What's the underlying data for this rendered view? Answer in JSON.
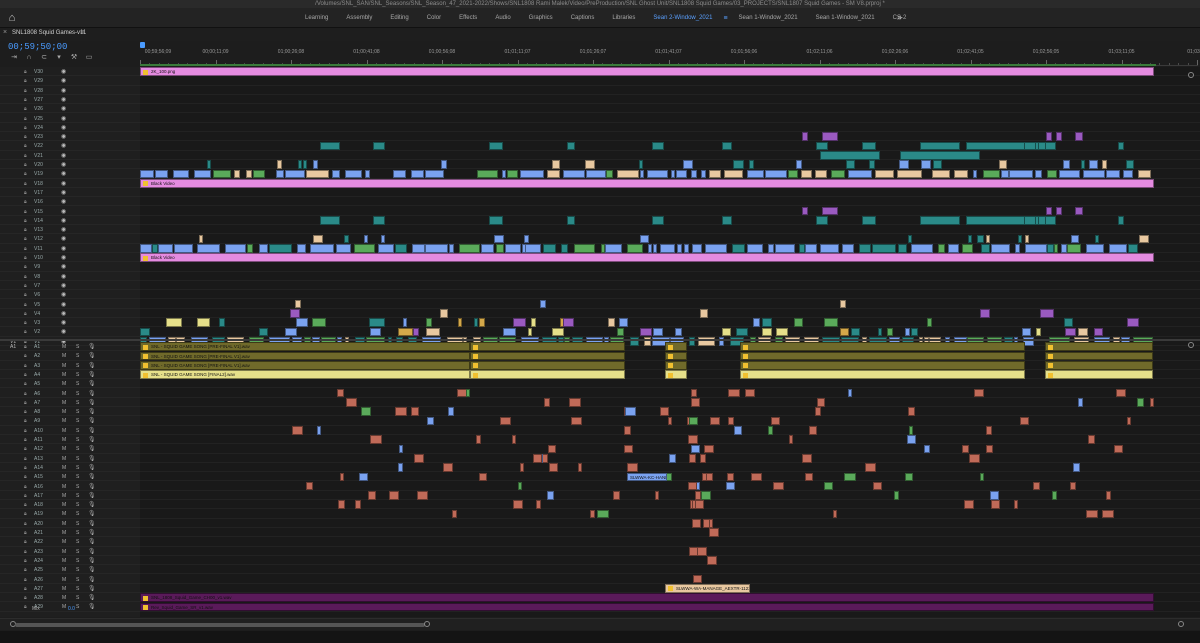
{
  "title": "/Volumes/SNL_SAN/SNL_Seasons/SNL_Season_47_2021-2022/Shows/SNL1808 Rami Malek/Video/PreProduction/SNL Ghost Unit/SNL1808 Squid Games/03_PROJECTS/SNL1807 Squid Games - SM V8.prproj *",
  "workspace": {
    "tabs": [
      "Learning",
      "Assembly",
      "Editing",
      "Color",
      "Effects",
      "Audio",
      "Graphics",
      "Captions",
      "Libraries"
    ],
    "active_tab": "Sean 2-Window_2021",
    "other_tabs": [
      "Sean 1-Window_2021",
      "Sean 1-Window_2021",
      "CS-2"
    ],
    "more_icon": "double-chevron-right-icon"
  },
  "sequence": {
    "name": "SNL1808 Squid Games-v11",
    "timecode": "00;59;50;00"
  },
  "ruler": {
    "labels": [
      "00;59;56;09",
      "00;00;11;09",
      "01;00;26;08",
      "01;00;41;08",
      "01;00;56;08",
      "01;01;11;07",
      "01;01;26;07",
      "01;01;41;07",
      "01;01;56;06",
      "01;02;11;06",
      "01;02;26;06",
      "01;02;41;05",
      "01;02;56;05",
      "01;03;11;05",
      "01;03;26"
    ]
  },
  "video_tracks": [
    "V30",
    "V29",
    "V28",
    "V27",
    "V26",
    "V25",
    "V24",
    "V23",
    "V22",
    "V21",
    "V20",
    "V19",
    "V18",
    "V17",
    "V16",
    "V15",
    "V14",
    "V13",
    "V12",
    "V11",
    "V10",
    "V9",
    "V8",
    "V7",
    "V6",
    "V5",
    "V4",
    "V3",
    "V2",
    "V1"
  ],
  "audio_tracks": [
    "A1",
    "A2",
    "A3",
    "A4",
    "A5",
    "A6",
    "A7",
    "A8",
    "A9",
    "A10",
    "A11",
    "A12",
    "A13",
    "A14",
    "A15",
    "A16",
    "A17",
    "A18",
    "A19",
    "A20",
    "A21",
    "A22",
    "A23",
    "A24",
    "A25",
    "A26",
    "A27",
    "A28",
    "A29"
  ],
  "source_patch": {
    "v": "V1",
    "a1": "A1",
    "a2": "A2"
  },
  "track_buttons": {
    "m": "M",
    "s": "S"
  },
  "right_labels": {
    "a28": "S1",
    "a29": "S2"
  },
  "mix": {
    "label": "Mix",
    "value": "0.0"
  },
  "clips": {
    "top_graphic": "2K_100.png",
    "black_video_1": "Black Video",
    "black_video_2": "Black Video",
    "song_1": "SNL - SQUID GAME SONG [PRE-FINAL V1].wav",
    "song_2": "SNL - SQUID GAME SONG [PRE-FINAL V1].wav",
    "song_3": "SNL - SQUID GAME SONG [PRE-FINAL V1].wav",
    "song_final": "SNL - SQUID GAME SONG [FINAL2].wav",
    "a28_clip": "SNL_1808_Squid_Game_CH00_v1.wav",
    "a29_clip": "Rev_Squid_Game_SR_v1.wav",
    "mid_clip": "SLWWA-KC-HANNA",
    "mid_clip_2": "SLWWA-WA-MANAGE_AEXTR-1123"
  }
}
